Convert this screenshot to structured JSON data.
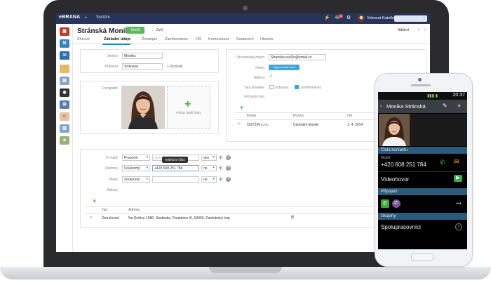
{
  "app": {
    "logo": "eBRANA",
    "logo_plus": "+",
    "system_label": "Systém",
    "user_name": "Vránová Kateřina",
    "notification_count": "1"
  },
  "record": {
    "title": "Stránská Monika",
    "save_label": "Uložit",
    "back_label": "Zpět",
    "preview_label": "Náhled",
    "nav_prev": "‹",
    "nav_next": "›"
  },
  "tabs": [
    "Shrnutí",
    "Základní údaje",
    "Životopis",
    "Zaměstnanec",
    "HR",
    "Komunikace",
    "Nastavení",
    "Historie"
  ],
  "form": {
    "first_name_label": "Jméno",
    "first_name_value": "Monika",
    "last_name_label": "Příjmení",
    "last_name_value": "Stránská",
    "expand_label": "Rozbalit",
    "photos_label": "Fotografie",
    "add_photo_label": "Přidat další fotky",
    "username_label": "Uživatelské jméno",
    "username_value": "Stranska.outZin@email.cz",
    "password_label": "Heslo",
    "generate_password_label": "Vygenerovat nové",
    "active_label": "Aktivní",
    "user_type_label": "Typ uživatele",
    "user_type_option1": "Uchazeč",
    "user_type_option2": "Zaměstnanec",
    "company_label": "Firma/pozice",
    "company_table_headers": [
      "Firma",
      "Pozice",
      "Od"
    ],
    "company_row": [
      "OUTZIN s.r.o.",
      "Centrální kiosek",
      "1. 4. 2014"
    ]
  },
  "contacts": {
    "email_label": "E-maily",
    "email_type": "Pracovní",
    "email_value": "stranska@outzin.cz",
    "email_primary": "ano",
    "phone_label": "Telefony",
    "phone_type": "Soukromý",
    "phone_value": "+420 608 251 784",
    "phone_primary": "ne",
    "tooltip": "Telefonní číslo",
    "web_label": "Weby",
    "web_type": "Soukromý",
    "web_primary": "ne",
    "address_label": "Adresy",
    "address_headers": [
      "Typ",
      "Adresa"
    ],
    "address_type": "Doručovací",
    "address_value": "Na Drážce 1580, Studánka, Pardubice III, 53003, Pardubický kraj"
  },
  "phone": {
    "time": "20:37",
    "contact_name": "Monika Stránská",
    "section_contacts": "Čísla kontaktu",
    "mobile_label": "Mobil",
    "mobile_value": "+420 608 251 784",
    "video_label": "Videohovor",
    "section_connections": "Připojení",
    "section_groups": "Skupiny",
    "group_value": "Spolupracovníci"
  },
  "colors": {
    "topbar": "#27355c",
    "accent_green": "#5cb85c",
    "accent_blue": "#3da5d9",
    "phone_section": "#2c5a7a"
  }
}
